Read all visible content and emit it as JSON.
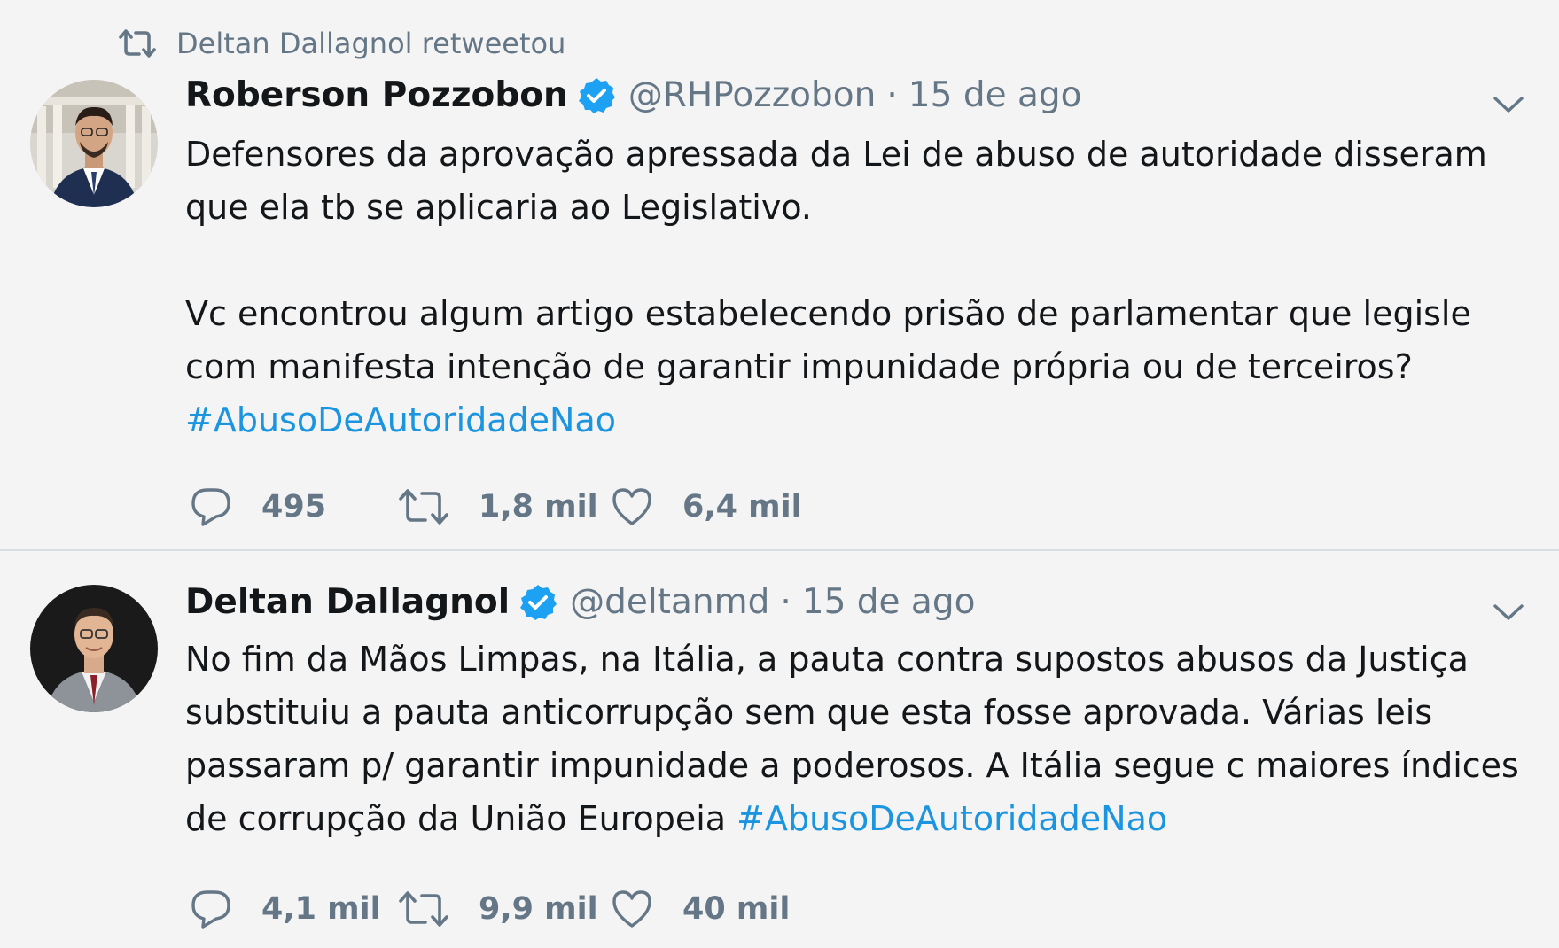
{
  "retweet_banner": {
    "text": "Deltan Dallagnol retweetou",
    "icon": "retweet-icon"
  },
  "tweets": [
    {
      "display_name": "Roberson Pozzobon",
      "handle": "@RHPozzobon",
      "separator": "·",
      "time": "15 de ago",
      "paragraph_1": "Defensores da aprovação apressada da Lei de abuso de autoridade disseram que ela tb se aplicaria ao Legislativo.",
      "paragraph_2": "Vc encontrou algum artigo estabelecendo prisão de parlamentar que legisle com manifesta intenção de garantir impunidade própria ou de terceiros?",
      "hashtag": "#AbusoDeAutoridadeNao",
      "replies": "495",
      "retweets": "1,8 mil",
      "likes": "6,4 mil"
    },
    {
      "display_name": "Deltan Dallagnol",
      "handle": "@deltanmd",
      "separator": "·",
      "time": "15 de ago",
      "text": "No fim da Mãos Limpas, na Itália, a pauta contra supostos abusos da Justiça substituiu a pauta anticorrupção sem que esta fosse aprovada. Várias leis passaram p/ garantir impunidade a poderosos. A Itália segue c maiores índices de corrupção da União Europeia ",
      "hashtag": "#AbusoDeAutoridadeNao",
      "replies": "4,1 mil",
      "retweets": "9,9 mil",
      "likes": "40 mil"
    }
  ],
  "colors": {
    "background": "#f4f4f4",
    "text": "#14171a",
    "muted": "#657786",
    "link": "#1b95e0",
    "verified": "#1da1f2"
  },
  "icons": [
    "retweet-icon",
    "verified-badge-icon",
    "chevron-down-icon",
    "reply-icon",
    "like-icon"
  ]
}
